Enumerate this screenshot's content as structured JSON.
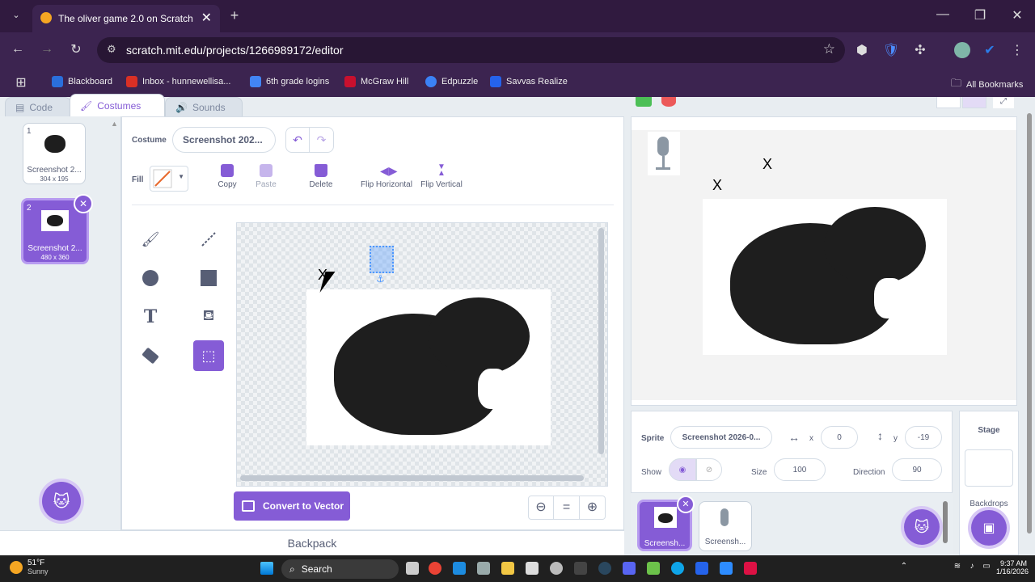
{
  "browser": {
    "tab_title": "The oliver game 2.0 on Scratch",
    "url": "scratch.mit.edu/projects/1266989172/editor",
    "bookmarks": [
      {
        "label": "Blackboard",
        "color": "#2a6fdb"
      },
      {
        "label": "Inbox - hunnewellisa...",
        "color": "#d93025"
      },
      {
        "label": "6th grade logins",
        "color": "#4285f4"
      },
      {
        "label": "McGraw Hill",
        "color": "#c8102e"
      },
      {
        "label": "Edpuzzle",
        "color": "#3b82f6"
      },
      {
        "label": "Savvas Realize",
        "color": "#2563eb"
      }
    ],
    "all_bookmarks": "All Bookmarks"
  },
  "editor": {
    "tabs": {
      "code": "Code",
      "costumes": "Costumes",
      "sounds": "Sounds"
    },
    "costumes": [
      {
        "num": "1",
        "name": "Screenshot 2...",
        "size": "304 x 195"
      },
      {
        "num": "2",
        "name": "Screenshot 2...",
        "size": "480 x 360"
      }
    ],
    "costume_label": "Costume",
    "costume_name": "Screenshot 202...",
    "fill_label": "Fill",
    "actions": {
      "copy": "Copy",
      "paste": "Paste",
      "delete": "Delete",
      "flip_h": "Flip Horizontal",
      "flip_v": "Flip Vertical"
    },
    "convert_button": "Convert to Vector",
    "zoom_reset": "=",
    "canvas_text": "X"
  },
  "stage": {
    "texts": [
      "X",
      "X"
    ]
  },
  "sprite_info": {
    "sprite_label": "Sprite",
    "sprite_name": "Screenshot 2026-0...",
    "x_label": "x",
    "x": "0",
    "y_label": "y",
    "y": "-19",
    "show_label": "Show",
    "size_label": "Size",
    "size": "100",
    "direction_label": "Direction",
    "direction": "90"
  },
  "sprites": [
    {
      "name": "Screensh..."
    },
    {
      "name": "Screensh..."
    }
  ],
  "stage_panel": {
    "title": "Stage",
    "backdrops": "Backdrops"
  },
  "backpack": "Backpack",
  "taskbar": {
    "weather_temp": "51°F",
    "weather_desc": "Sunny",
    "search": "Search",
    "time": "9:37 AM",
    "date": "1/16/2026"
  },
  "colors": {
    "accent": "#855cd6",
    "blue": "#4c97ff",
    "bg": "#e8edf1"
  }
}
